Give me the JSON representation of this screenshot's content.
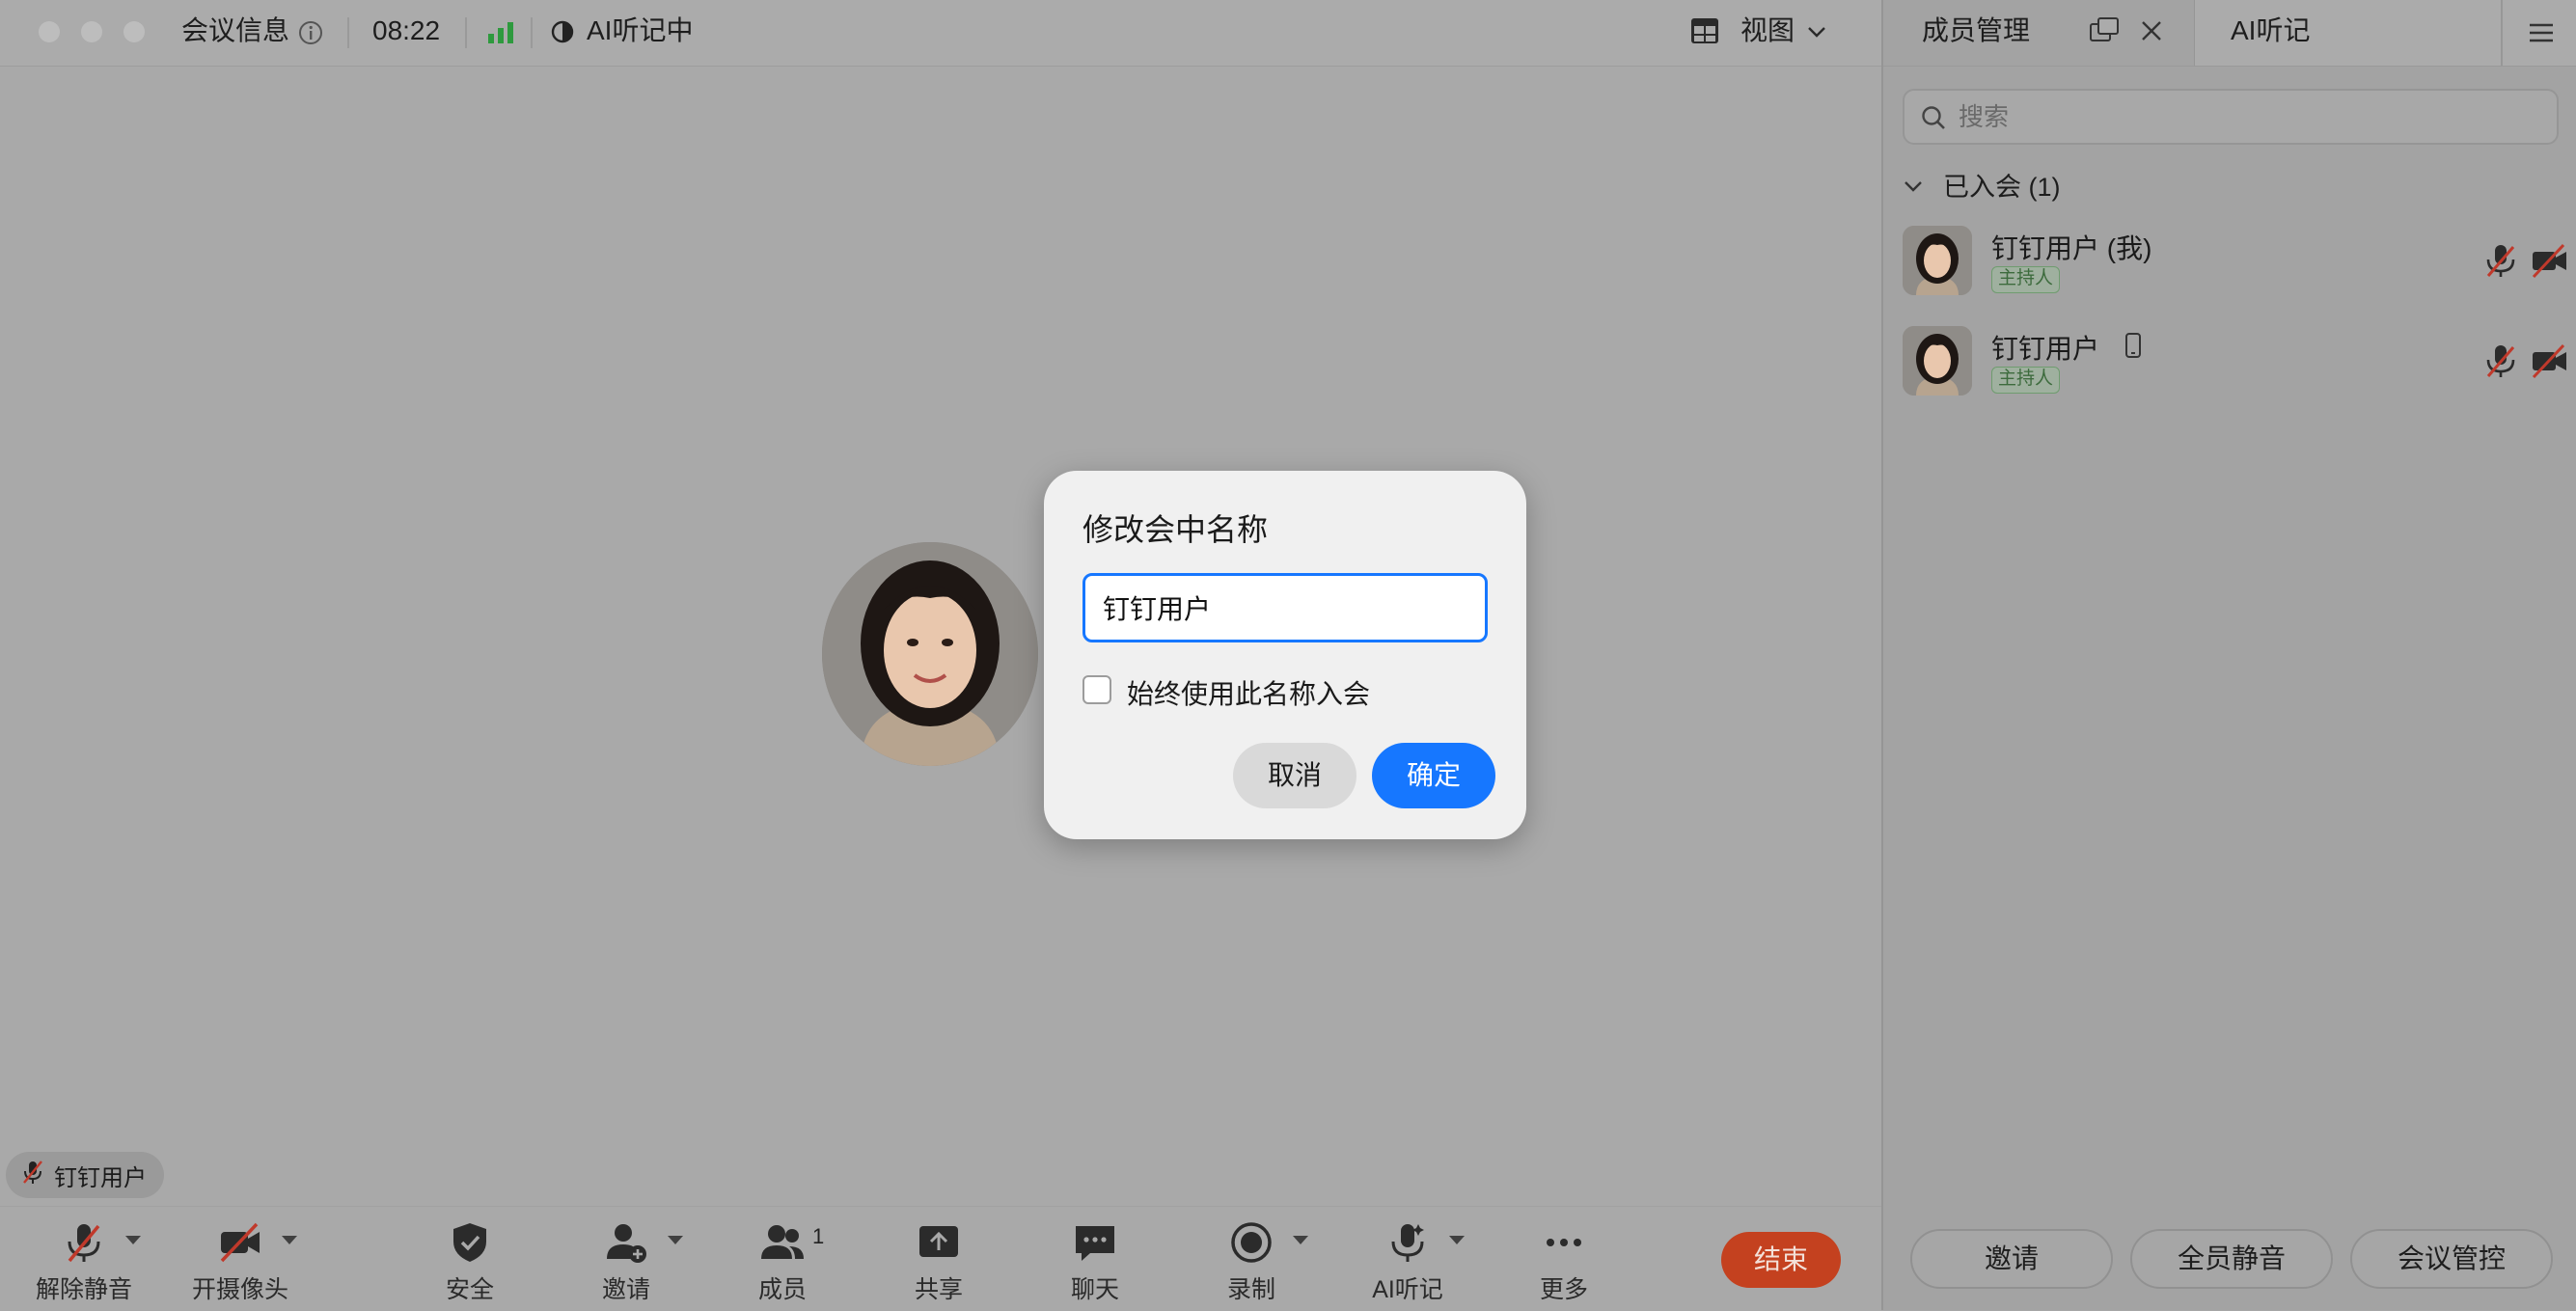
{
  "topbar": {
    "meeting_info": "会议信息",
    "timer": "08:22",
    "ai_status": "AI听记中",
    "view_label": "视图"
  },
  "stage": {
    "name_tag": "钉钉用户"
  },
  "toolbar": {
    "unmute": "解除静音",
    "camera": "开摄像头",
    "security": "安全",
    "invite": "邀请",
    "members": "成员",
    "members_count": "1",
    "share": "共享",
    "chat": "聊天",
    "record": "录制",
    "ai_notes": "AI听记",
    "more": "更多",
    "end": "结束"
  },
  "panel": {
    "tab_members": "成员管理",
    "tab_ai": "AI听记",
    "search_placeholder": "搜索",
    "group_label": "已入会 (1)",
    "members": [
      {
        "name": "钉钉用户 (我)",
        "role": "主持人"
      },
      {
        "name": "钉钉用户",
        "role": "主持人"
      }
    ],
    "btn_invite": "邀请",
    "btn_mute_all": "全员静音",
    "btn_control": "会议管控"
  },
  "dialog": {
    "title": "修改会中名称",
    "input_value": "钉钉用户",
    "checkbox_label": "始终使用此名称入会",
    "cancel": "取消",
    "ok": "确定"
  },
  "colors": {
    "accent": "#1677ff",
    "end_button": "#c4411f",
    "signal_green": "#2e9a3e"
  }
}
